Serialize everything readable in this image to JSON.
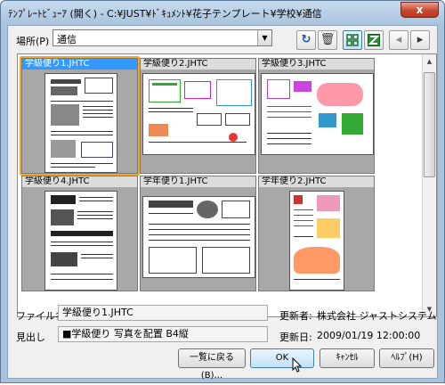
{
  "window": {
    "title": "ﾃﾝﾌﾟﾚｰﾄﾋﾞｭｰｱ (開く) - C:¥JUST¥ﾄﾞｷｭﾒﾝﾄ¥花子テンプレート¥学校¥通信",
    "close_label": "x"
  },
  "location": {
    "label": "場所(P)",
    "value": "通信"
  },
  "toolbar": {
    "refresh_icon": "refresh-icon",
    "delete_icon": "trash-icon",
    "thumbnail_icon": "thumbnail-view-icon",
    "app_icon": "hanako-app-icon",
    "prev_icon": "chevron-left-icon",
    "next_icon": "chevron-right-icon"
  },
  "templates": [
    {
      "name": "学級便り1.JHTC",
      "selected": true
    },
    {
      "name": "学級便り2.JHTC",
      "selected": false
    },
    {
      "name": "学級便り3.JHTC",
      "selected": false
    },
    {
      "name": "学級便り4.JHTC",
      "selected": false
    },
    {
      "name": "学年便り1.JHTC",
      "selected": false
    },
    {
      "name": "学年便り2.JHTC",
      "selected": false
    }
  ],
  "info": {
    "filename_label": "ファイル名",
    "filename_value": "学級便り1.JHTC",
    "heading_label": "見出し",
    "heading_value": "■学級便り 写真を配置 B4縦",
    "updater_label": "更新者:",
    "updater_value": "株式会社 ジャストシステム",
    "updated_label": "更新日:",
    "updated_value": "2009/01/19 12:00:00"
  },
  "buttons": {
    "list_back": "一覧に戻る(B)...",
    "ok": "OK",
    "cancel": "ｷｬﾝｾﾙ",
    "help": "ﾍﾙﾌﾟ(H)"
  },
  "colors": {
    "selection_caption": "#3399ff",
    "selection_frame": "#f6a623",
    "cell_background": "#a8a8a8"
  }
}
